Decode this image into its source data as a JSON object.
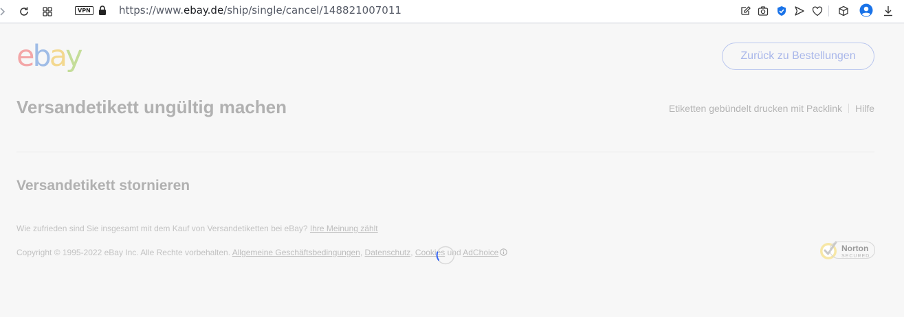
{
  "browser": {
    "vpn_label": "VPN",
    "url_prefix": "https://www.",
    "url_host": "ebay.de",
    "url_path": "/ship/single/cancel/148821007011"
  },
  "header": {
    "logo": {
      "e": "e",
      "b": "b",
      "a": "a",
      "y": "y"
    },
    "back_button": "Zurück zu Bestellungen"
  },
  "main": {
    "title": "Versandetikett ungültig machen",
    "links": [
      "Etiketten gebündelt drucken mit Packlink",
      "Hilfe"
    ],
    "section_title": "Versandetikett stornieren"
  },
  "footer": {
    "survey_text": "Wie zufrieden sind Sie insgesamt mit dem Kauf von Versandetiketten bei eBay? ",
    "survey_link": "Ihre Meinung zählt",
    "copyright": "Copyright © 1995-2022 eBay Inc. Alle Rechte vorbehalten. ",
    "terms_link": "Allgemeine Geschäftsbedingungen",
    "sep1": ", ",
    "privacy_link": "Datenschutz",
    "sep2": ", ",
    "cookies_link": "Cookies",
    "and_text": " und ",
    "adchoice_link": "AdChoice"
  },
  "norton": {
    "line1": "Norton",
    "line2": "SECURED"
  },
  "colors": {
    "brand_blue_faded": "#a9b7ea",
    "title_gray": "#b1b1b1",
    "spinner_blue": "#3665f3"
  },
  "icons": [
    "reload-icon",
    "apps-grid-icon",
    "lock-icon",
    "edit-icon",
    "camera-icon",
    "shield-check-icon",
    "send-icon",
    "heart-icon",
    "cube-icon",
    "profile-icon",
    "download-icon",
    "info-icon",
    "norton-check-icon"
  ]
}
